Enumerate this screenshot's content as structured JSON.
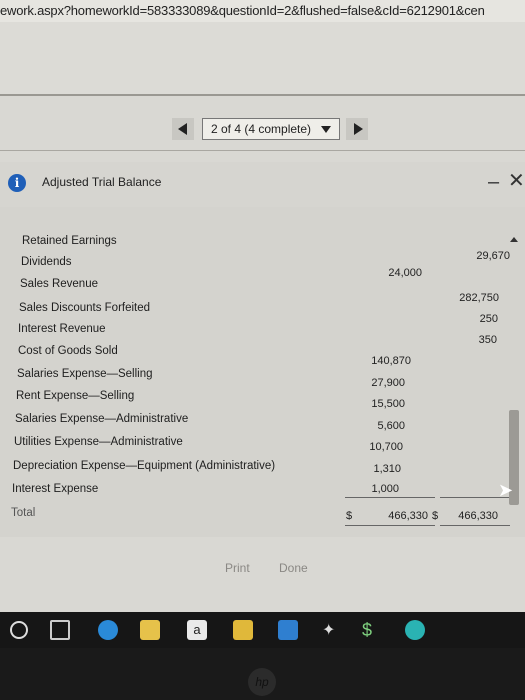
{
  "browser": {
    "url": "ework.aspx?homeworkId=583333089&questionId=2&flushed=false&cId=6212901&cen"
  },
  "pager": {
    "label": "2 of 4 (4 complete)"
  },
  "panel": {
    "title": "Adjusted Trial Balance",
    "info_icon": "i"
  },
  "table": {
    "rows": [
      {
        "label": "Retained Earnings",
        "debit": "",
        "credit": "29,670"
      },
      {
        "label": "Dividends",
        "debit": "24,000",
        "credit": ""
      },
      {
        "label": "Sales Revenue",
        "debit": "",
        "credit": "282,750"
      },
      {
        "label": "Sales Discounts Forfeited",
        "debit": "",
        "credit": "250"
      },
      {
        "label": "Interest Revenue",
        "debit": "",
        "credit": "350"
      },
      {
        "label": "Cost of Goods Sold",
        "debit": "140,870",
        "credit": ""
      },
      {
        "label": "Salaries Expense—Selling",
        "debit": "27,900",
        "credit": ""
      },
      {
        "label": "Rent Expense—Selling",
        "debit": "15,500",
        "credit": ""
      },
      {
        "label": "Salaries Expense—Administrative",
        "debit": "5,600",
        "credit": ""
      },
      {
        "label": "Utilities Expense—Administrative",
        "debit": "10,700",
        "credit": ""
      },
      {
        "label": "Depreciation Expense—Equipment (Administrative)",
        "debit": "1,310",
        "credit": ""
      },
      {
        "label": "Interest Expense",
        "debit": "1,000",
        "credit": ""
      }
    ],
    "total": {
      "label": "Total",
      "debit_symbol": "$",
      "debit": "466,330",
      "credit_symbol": "$",
      "credit": "466,330"
    }
  },
  "footer": {
    "print_label": "Print",
    "done_label": "Done"
  },
  "taskbar": {
    "icons": [
      "start-icon",
      "task-view-icon",
      "edge-icon",
      "file-explorer-icon",
      "amazon-icon",
      "store-icon",
      "mail-icon",
      "dropbox-icon",
      "dollar-icon",
      "app-icon"
    ]
  },
  "colors": {
    "info": "#1f5fb8",
    "background": "#d4d3ce"
  }
}
